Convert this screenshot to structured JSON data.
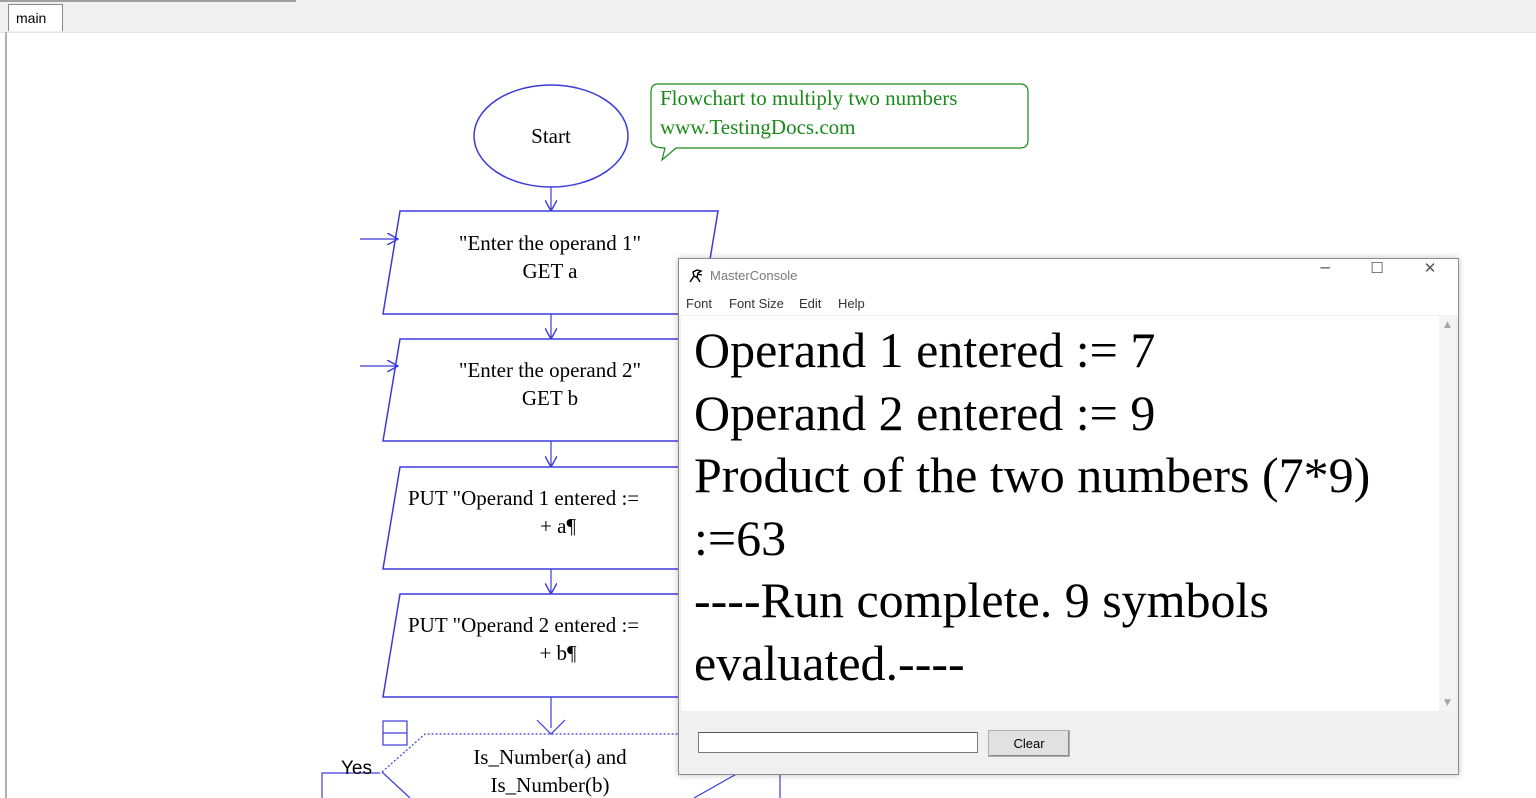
{
  "editor": {
    "tab_label": "main"
  },
  "flowchart": {
    "start_label": "Start",
    "comment_line1": "Flowchart to multiply two numbers",
    "comment_line2": "www.TestingDocs.com",
    "input1_line1": "\"Enter the operand 1\"",
    "input1_line2": "GET a",
    "input2_line1": "\"Enter the operand 2\"",
    "input2_line2": "GET b",
    "output1_line1": "PUT \"Operand 1 entered :=",
    "output1_line2": "+ a¶",
    "output2_line1": "PUT \"Operand 2 entered :=",
    "output2_line2": "+ b¶",
    "decision_line1": "Is_Number(a) and",
    "decision_line2": "Is_Number(b)",
    "yes_label": "Yes",
    "shape_color": "#3b3bdc",
    "comment_color": "#1a8a1a"
  },
  "console": {
    "title": "MasterConsole",
    "menu": [
      "Font",
      "Font Size",
      "Edit",
      "Help"
    ],
    "output_lines": [
      "Operand 1 entered := 7",
      "Operand 2 entered := 9",
      "Product of the two numbers (7*9)",
      ":=63",
      "----Run complete.  9 symbols",
      "evaluated.----"
    ],
    "input_value": "",
    "clear_label": "Clear"
  }
}
